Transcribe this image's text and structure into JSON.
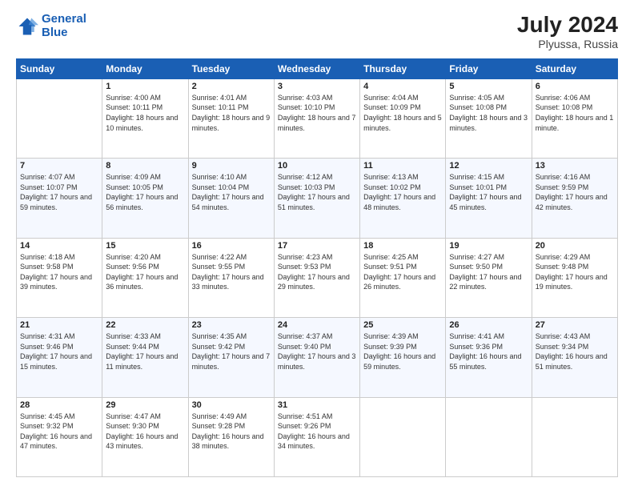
{
  "logo": {
    "line1": "General",
    "line2": "Blue"
  },
  "title": "July 2024",
  "location": "Plyussa, Russia",
  "days_header": [
    "Sunday",
    "Monday",
    "Tuesday",
    "Wednesday",
    "Thursday",
    "Friday",
    "Saturday"
  ],
  "weeks": [
    [
      {
        "day": "",
        "sunrise": "",
        "sunset": "",
        "daylight": ""
      },
      {
        "day": "1",
        "sunrise": "Sunrise: 4:00 AM",
        "sunset": "Sunset: 10:11 PM",
        "daylight": "Daylight: 18 hours and 10 minutes."
      },
      {
        "day": "2",
        "sunrise": "Sunrise: 4:01 AM",
        "sunset": "Sunset: 10:11 PM",
        "daylight": "Daylight: 18 hours and 9 minutes."
      },
      {
        "day": "3",
        "sunrise": "Sunrise: 4:03 AM",
        "sunset": "Sunset: 10:10 PM",
        "daylight": "Daylight: 18 hours and 7 minutes."
      },
      {
        "day": "4",
        "sunrise": "Sunrise: 4:04 AM",
        "sunset": "Sunset: 10:09 PM",
        "daylight": "Daylight: 18 hours and 5 minutes."
      },
      {
        "day": "5",
        "sunrise": "Sunrise: 4:05 AM",
        "sunset": "Sunset: 10:08 PM",
        "daylight": "Daylight: 18 hours and 3 minutes."
      },
      {
        "day": "6",
        "sunrise": "Sunrise: 4:06 AM",
        "sunset": "Sunset: 10:08 PM",
        "daylight": "Daylight: 18 hours and 1 minute."
      }
    ],
    [
      {
        "day": "7",
        "sunrise": "Sunrise: 4:07 AM",
        "sunset": "Sunset: 10:07 PM",
        "daylight": "Daylight: 17 hours and 59 minutes."
      },
      {
        "day": "8",
        "sunrise": "Sunrise: 4:09 AM",
        "sunset": "Sunset: 10:05 PM",
        "daylight": "Daylight: 17 hours and 56 minutes."
      },
      {
        "day": "9",
        "sunrise": "Sunrise: 4:10 AM",
        "sunset": "Sunset: 10:04 PM",
        "daylight": "Daylight: 17 hours and 54 minutes."
      },
      {
        "day": "10",
        "sunrise": "Sunrise: 4:12 AM",
        "sunset": "Sunset: 10:03 PM",
        "daylight": "Daylight: 17 hours and 51 minutes."
      },
      {
        "day": "11",
        "sunrise": "Sunrise: 4:13 AM",
        "sunset": "Sunset: 10:02 PM",
        "daylight": "Daylight: 17 hours and 48 minutes."
      },
      {
        "day": "12",
        "sunrise": "Sunrise: 4:15 AM",
        "sunset": "Sunset: 10:01 PM",
        "daylight": "Daylight: 17 hours and 45 minutes."
      },
      {
        "day": "13",
        "sunrise": "Sunrise: 4:16 AM",
        "sunset": "Sunset: 9:59 PM",
        "daylight": "Daylight: 17 hours and 42 minutes."
      }
    ],
    [
      {
        "day": "14",
        "sunrise": "Sunrise: 4:18 AM",
        "sunset": "Sunset: 9:58 PM",
        "daylight": "Daylight: 17 hours and 39 minutes."
      },
      {
        "day": "15",
        "sunrise": "Sunrise: 4:20 AM",
        "sunset": "Sunset: 9:56 PM",
        "daylight": "Daylight: 17 hours and 36 minutes."
      },
      {
        "day": "16",
        "sunrise": "Sunrise: 4:22 AM",
        "sunset": "Sunset: 9:55 PM",
        "daylight": "Daylight: 17 hours and 33 minutes."
      },
      {
        "day": "17",
        "sunrise": "Sunrise: 4:23 AM",
        "sunset": "Sunset: 9:53 PM",
        "daylight": "Daylight: 17 hours and 29 minutes."
      },
      {
        "day": "18",
        "sunrise": "Sunrise: 4:25 AM",
        "sunset": "Sunset: 9:51 PM",
        "daylight": "Daylight: 17 hours and 26 minutes."
      },
      {
        "day": "19",
        "sunrise": "Sunrise: 4:27 AM",
        "sunset": "Sunset: 9:50 PM",
        "daylight": "Daylight: 17 hours and 22 minutes."
      },
      {
        "day": "20",
        "sunrise": "Sunrise: 4:29 AM",
        "sunset": "Sunset: 9:48 PM",
        "daylight": "Daylight: 17 hours and 19 minutes."
      }
    ],
    [
      {
        "day": "21",
        "sunrise": "Sunrise: 4:31 AM",
        "sunset": "Sunset: 9:46 PM",
        "daylight": "Daylight: 17 hours and 15 minutes."
      },
      {
        "day": "22",
        "sunrise": "Sunrise: 4:33 AM",
        "sunset": "Sunset: 9:44 PM",
        "daylight": "Daylight: 17 hours and 11 minutes."
      },
      {
        "day": "23",
        "sunrise": "Sunrise: 4:35 AM",
        "sunset": "Sunset: 9:42 PM",
        "daylight": "Daylight: 17 hours and 7 minutes."
      },
      {
        "day": "24",
        "sunrise": "Sunrise: 4:37 AM",
        "sunset": "Sunset: 9:40 PM",
        "daylight": "Daylight: 17 hours and 3 minutes."
      },
      {
        "day": "25",
        "sunrise": "Sunrise: 4:39 AM",
        "sunset": "Sunset: 9:39 PM",
        "daylight": "Daylight: 16 hours and 59 minutes."
      },
      {
        "day": "26",
        "sunrise": "Sunrise: 4:41 AM",
        "sunset": "Sunset: 9:36 PM",
        "daylight": "Daylight: 16 hours and 55 minutes."
      },
      {
        "day": "27",
        "sunrise": "Sunrise: 4:43 AM",
        "sunset": "Sunset: 9:34 PM",
        "daylight": "Daylight: 16 hours and 51 minutes."
      }
    ],
    [
      {
        "day": "28",
        "sunrise": "Sunrise: 4:45 AM",
        "sunset": "Sunset: 9:32 PM",
        "daylight": "Daylight: 16 hours and 47 minutes."
      },
      {
        "day": "29",
        "sunrise": "Sunrise: 4:47 AM",
        "sunset": "Sunset: 9:30 PM",
        "daylight": "Daylight: 16 hours and 43 minutes."
      },
      {
        "day": "30",
        "sunrise": "Sunrise: 4:49 AM",
        "sunset": "Sunset: 9:28 PM",
        "daylight": "Daylight: 16 hours and 38 minutes."
      },
      {
        "day": "31",
        "sunrise": "Sunrise: 4:51 AM",
        "sunset": "Sunset: 9:26 PM",
        "daylight": "Daylight: 16 hours and 34 minutes."
      },
      {
        "day": "",
        "sunrise": "",
        "sunset": "",
        "daylight": ""
      },
      {
        "day": "",
        "sunrise": "",
        "sunset": "",
        "daylight": ""
      },
      {
        "day": "",
        "sunrise": "",
        "sunset": "",
        "daylight": ""
      }
    ]
  ]
}
